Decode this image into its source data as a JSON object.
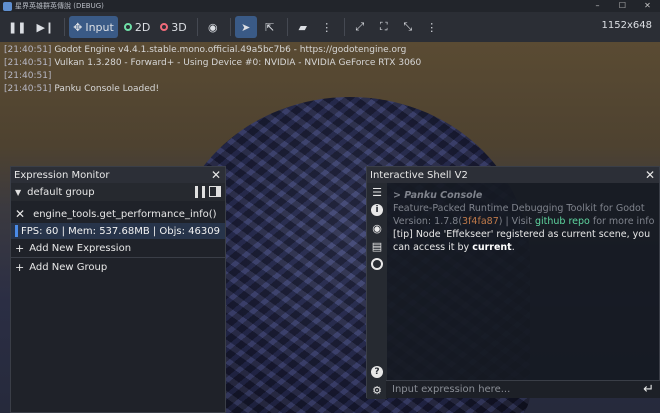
{
  "window": {
    "title": "星界英雄群英傳說 (DEBUG)",
    "controls": [
      "–",
      "☐",
      "✕"
    ]
  },
  "toolbar": {
    "input_label": "Input",
    "mode_2d": "2D",
    "mode_3d": "3D",
    "resolution": "1152x648"
  },
  "log": [
    {
      "time": "[21:40:51]",
      "text": "Godot Engine v4.4.1.stable.mono.official.49a5bc7b6 - https://godotengine.org"
    },
    {
      "time": "[21:40:51]",
      "text": "Vulkan 1.3.280 - Forward+ - Using Device #0: NVIDIA - NVIDIA GeForce RTX 3060"
    },
    {
      "time": "[21:40:51]",
      "text": ""
    },
    {
      "time": "[21:40:51]",
      "text": "Panku Console Loaded!"
    }
  ],
  "expression_monitor": {
    "title": "Expression Monitor",
    "group_name": "default group",
    "expression": "engine_tools.get_performance_info()",
    "result": "FPS: 60 | Mem: 537.68MB | Objs: 46309",
    "add_expression_label": "Add New Expression",
    "add_group_label": "Add New Group"
  },
  "shell": {
    "title": "Interactive Shell V2",
    "brand": "> Panku Console",
    "tagline": "Feature-Packed Runtime Debugging Toolkit for Godot",
    "version_prefix": "Version: 1.7.8(",
    "version_hash": "3f4fa87",
    "version_suffix": ") | Visit ",
    "repo_link": "github repo",
    "repo_suffix": " for more info",
    "tip_prefix": "[tip] Node 'Effekseer' registered as current scene, you can access it by ",
    "tip_keyword": "current",
    "tip_end": ".",
    "input_placeholder": "Input expression here..."
  },
  "colors": {
    "accent": "#3a5a86",
    "link": "#5fd6a0",
    "hash": "#c07a4a",
    "result_bar": "#4a8be8"
  }
}
